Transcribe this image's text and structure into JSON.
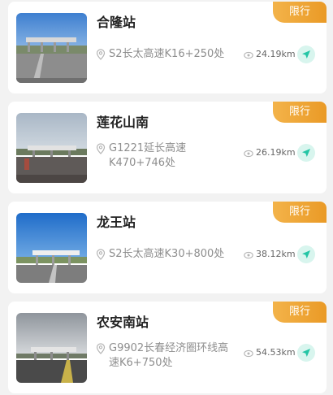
{
  "stations": [
    {
      "name": "合隆站",
      "badge": "限行",
      "address": "S2长太高速K16+250处",
      "distance": "24.19km",
      "image": "toll-station-photo"
    },
    {
      "name": "莲花山南",
      "badge": "限行",
      "address": "G1221延长高速K470+746处",
      "distance": "26.19km",
      "image": "toll-station-photo"
    },
    {
      "name": "龙王站",
      "badge": "限行",
      "address": "S2长太高速K30+800处",
      "distance": "38.12km",
      "image": "toll-station-photo"
    },
    {
      "name": "农安南站",
      "badge": "限行",
      "address": "G9902长春经济圈环线高速K6+750处",
      "distance": "54.53km",
      "image": "toll-station-photo"
    }
  ],
  "icons": {
    "location": "location-pin-icon",
    "distance": "eye-icon",
    "navigate": "navigation-arrow-icon"
  },
  "colors": {
    "badge": "#ea9a26",
    "title": "#222222",
    "secondary": "#8e8e8e",
    "nav_accent": "#25c5a5",
    "background": "#f2f2f2"
  }
}
